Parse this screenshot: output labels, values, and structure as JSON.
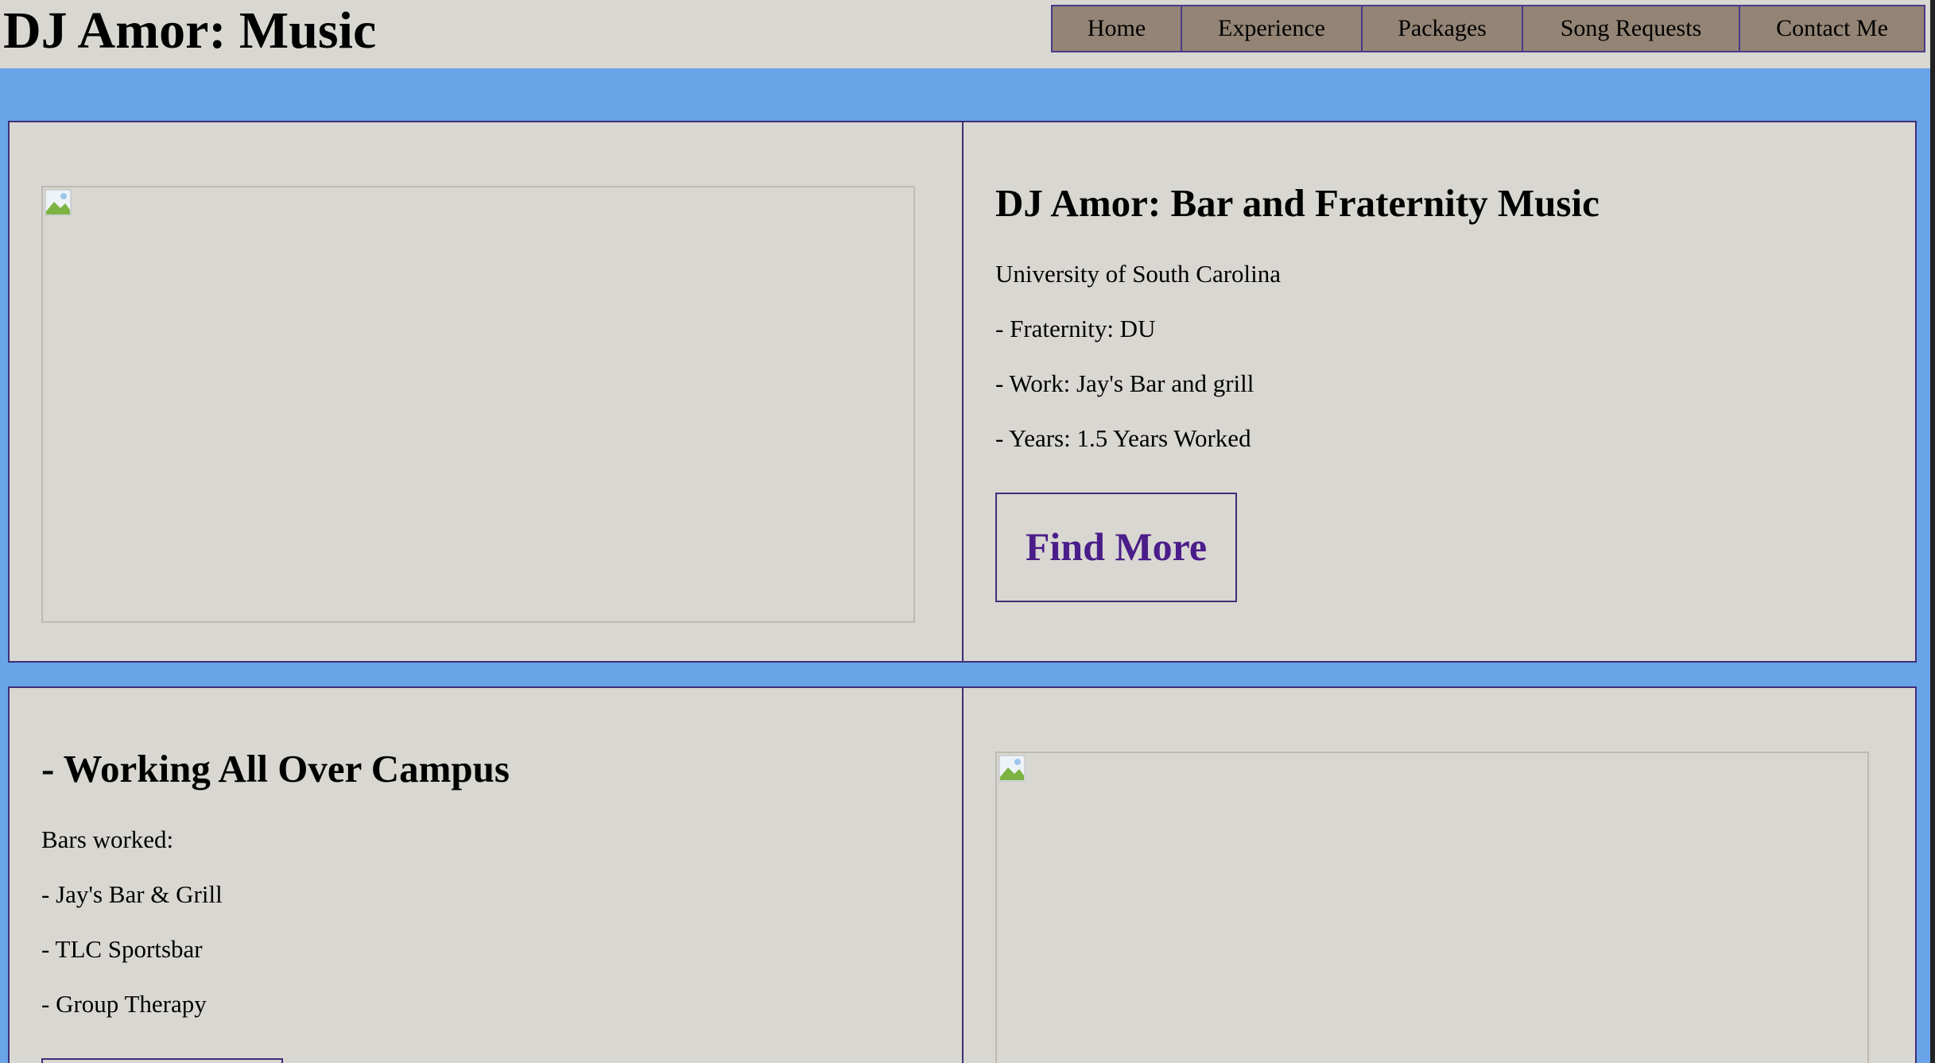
{
  "header": {
    "title": "DJ Amor: Music",
    "nav": [
      "Home",
      "Experience",
      "Packages",
      "Song Requests",
      "Contact Me"
    ]
  },
  "section1": {
    "heading": "DJ Amor: Bar and Fraternity Music",
    "lines": [
      "University of South Carolina",
      "- Fraternity: DU",
      "- Work: Jay's Bar and grill",
      "- Years: 1.5 Years Worked"
    ],
    "button": "Find More"
  },
  "section2": {
    "heading": "- Working All Over Campus",
    "lines": [
      "Bars worked:",
      "- Jay's Bar & Grill",
      "- TLC Sportsbar",
      "- Group Therapy"
    ]
  },
  "colors": {
    "background": "#6aa4e8",
    "panel": "#d9d7d1",
    "nav": "#938475",
    "border": "#3c2f78",
    "button_text": "#4a1d8a"
  }
}
